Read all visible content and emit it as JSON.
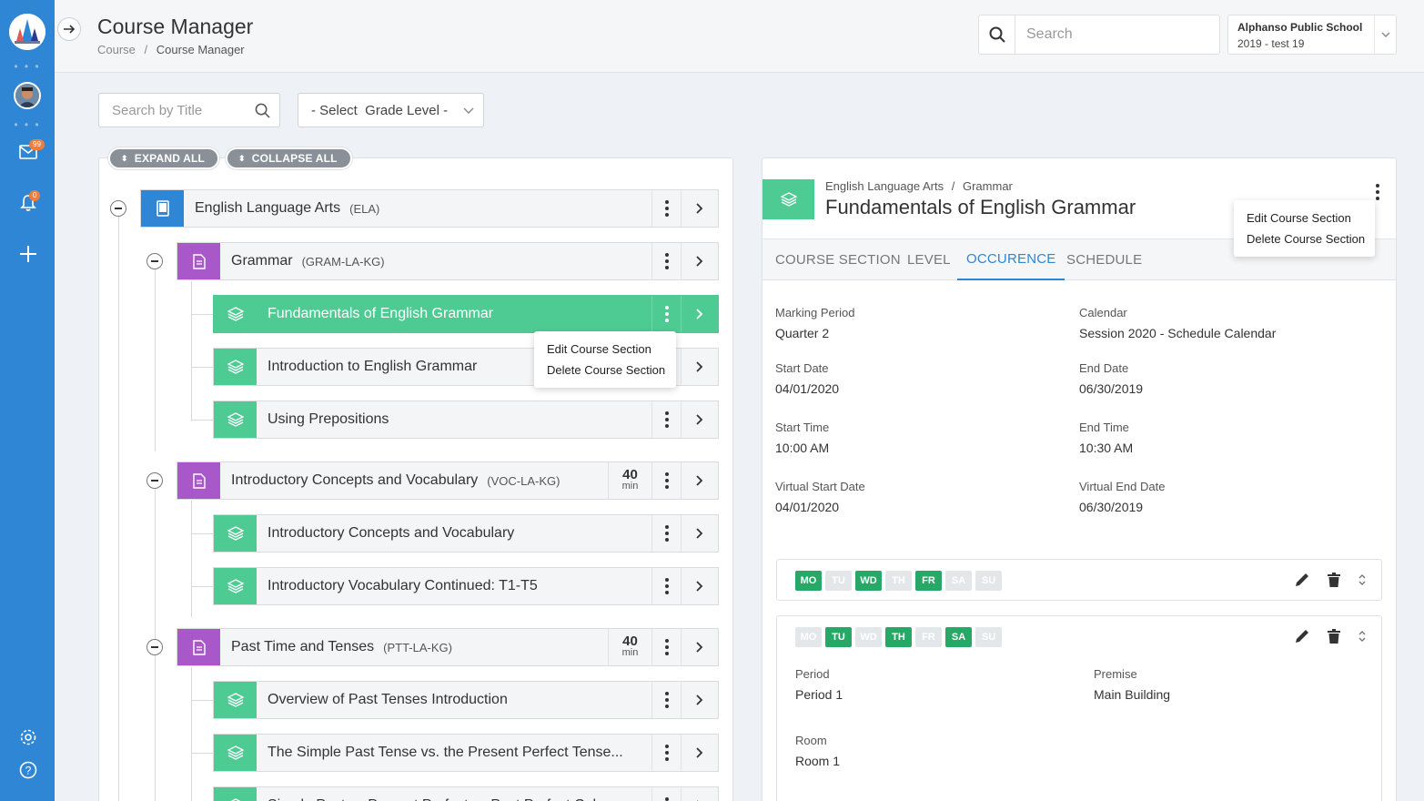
{
  "header": {
    "title": "Course Manager",
    "breadcrumb": [
      "Course",
      "Course Manager"
    ],
    "breadcrumb_sep": "/",
    "search_placeholder": "Search",
    "school_name": "Alphanso Public School",
    "school_year": "2019 - test 19"
  },
  "sidebar": {
    "mail_badge": "99",
    "bell_badge": "0",
    "accent": "#2f86d4"
  },
  "filters": {
    "title_placeholder": "Search by Title",
    "grade_select": "- Select  Grade Level -"
  },
  "tree_controls": {
    "expand_all": "EXPAND ALL",
    "collapse_all": "COLLAPSE ALL"
  },
  "tree": {
    "course": {
      "title": "English Language Arts",
      "code": "(ELA)"
    },
    "subjects": [
      {
        "title": "Grammar",
        "code": "(GRAM-LA-KG)",
        "minutes": "",
        "min_unit": ""
      },
      {
        "title": "Introductory Concepts and Vocabulary",
        "code": "(VOC-LA-KG)",
        "minutes": "40",
        "min_unit": "min"
      },
      {
        "title": "Past Time and Tenses",
        "code": "(PTT-LA-KG)",
        "minutes": "40",
        "min_unit": "min"
      }
    ],
    "sections": [
      {
        "title": "Fundamentals of English Grammar"
      },
      {
        "title": "Introduction to English Grammar"
      },
      {
        "title": "Using Prepositions"
      },
      {
        "title": "Introductory Concepts and Vocabulary"
      },
      {
        "title": "Introductory Vocabulary Continued: T1-T5"
      },
      {
        "title": "Overview of Past Tenses Introduction"
      },
      {
        "title": "The Simple Past Tense vs. the Present Perfect Tense..."
      },
      {
        "title": "Simple Past vs Present Perfect vs Past Perfect Cal..."
      }
    ]
  },
  "context_menu": {
    "edit": "Edit Course Section",
    "delete": "Delete Course Section"
  },
  "detail": {
    "crumb_parent": "English Language Arts",
    "crumb_sep": "/",
    "crumb_child": "Grammar",
    "title": "Fundamentals of English Grammar",
    "tabs": [
      "COURSE SECTION",
      "LEVEL",
      "OCCURENCE",
      "SCHEDULE"
    ],
    "active_tab": "OCCURENCE",
    "fields": {
      "marking_period_label": "Marking Period",
      "marking_period": "Quarter 2",
      "calendar_label": "Calendar",
      "calendar": "Session 2020 - Schedule Calendar",
      "start_date_label": "Start Date",
      "start_date": "04/01/2020",
      "end_date_label": "End Date",
      "end_date": "06/30/2019",
      "start_time_label": "Start Time",
      "start_time": "10:00 AM",
      "end_time_label": "End Time",
      "end_time": "10:30 AM",
      "vstart_label": "Virtual Start Date",
      "vstart": "04/01/2020",
      "vend_label": "Virtual End Date",
      "vend": "06/30/2019"
    },
    "schedules": [
      {
        "days": [
          "MO",
          "TU",
          "WD",
          "TH",
          "FR",
          "SA",
          "SU"
        ],
        "active": [
          true,
          false,
          true,
          false,
          true,
          false,
          false
        ]
      },
      {
        "days": [
          "MO",
          "TU",
          "WD",
          "TH",
          "FR",
          "SA",
          "SU"
        ],
        "active": [
          false,
          true,
          false,
          true,
          false,
          true,
          false
        ],
        "period_label": "Period",
        "period": "Period 1",
        "premise_label": "Premise",
        "premise": "Main Building",
        "room_label": "Room",
        "room": "Room 1"
      }
    ]
  }
}
